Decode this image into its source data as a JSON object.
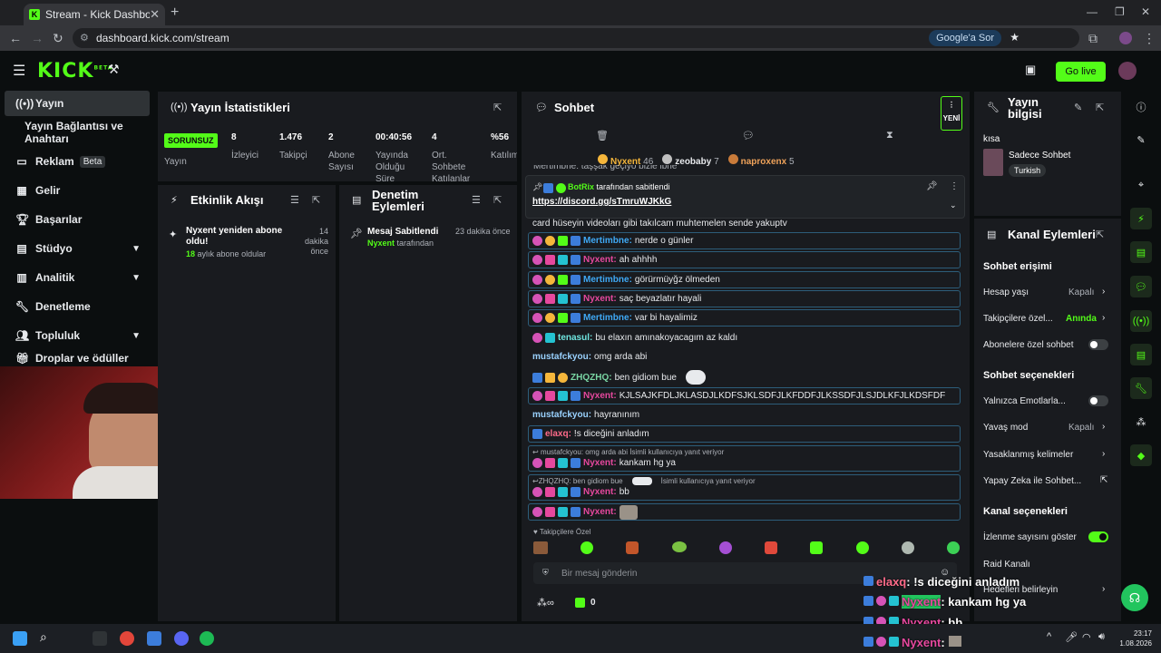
{
  "browser": {
    "tab_title": "Stream - Kick Dashboard",
    "url": "dashboard.kick.com/stream",
    "google_button": "Google'a Sor"
  },
  "header": {
    "logo": "KICK",
    "logo_sup": "BETA",
    "go_live": "Go live"
  },
  "sidebar": {
    "items": [
      {
        "label": "Yayın"
      },
      {
        "label": "Yayın Bağlantısı ve Anahtarı"
      },
      {
        "label": "Reklam",
        "badge": "Beta"
      },
      {
        "label": "Gelir"
      },
      {
        "label": "Başarılar"
      },
      {
        "label": "Stüdyo"
      },
      {
        "label": "Analitik"
      },
      {
        "label": "Denetleme"
      },
      {
        "label": "Topluluk"
      },
      {
        "label": "Droplar ve ödüller"
      }
    ]
  },
  "stats": {
    "title": "Yayın İstatistikleri",
    "status": "SORUNSUZ",
    "status_label": "Yayın",
    "items": [
      {
        "value": "8",
        "label": "İzleyici"
      },
      {
        "value": "1.476",
        "label": "Takipçi"
      },
      {
        "value": "2",
        "label": "Abone Sayısı"
      },
      {
        "value": "00:40:56",
        "label": "Yayında Olduğu Süre"
      },
      {
        "value": "4",
        "label": "Ort. Sohbete Katılanlar"
      },
      {
        "value": "%56",
        "label": "Katılım"
      }
    ]
  },
  "activity": {
    "title": "Etkinlik Akışı",
    "event_title": "Nyxent yeniden abone oldu!",
    "event_sub_count": "18",
    "event_sub_text": "aylık abone oldular",
    "event_time": "14 dakika önce"
  },
  "moderation": {
    "title": "Denetim Eylemleri",
    "action_title": "Mesaj Sabitlendi",
    "action_user": "Nyxent",
    "action_suffix": "tarafından",
    "action_time": "23 dakika önce"
  },
  "chat": {
    "title": "Sohbet",
    "new_label": "YENİ",
    "leaders": [
      {
        "name": "Nyxent",
        "count": "46"
      },
      {
        "name": "zeobaby",
        "count": "7"
      },
      {
        "name": "naproxenx",
        "count": "5"
      }
    ],
    "cut_line": "Mertimbne: taşşak geçiyo bizle ibne",
    "pinned": {
      "user": "BotRix",
      "pinned_text": "tarafından sabitlendi",
      "link": "https://discord.gg/sTmruWJKkG"
    },
    "partial_line": "card hüseyin videoları gibi takılcam muhtemelen sende yakuptv",
    "messages": [
      {
        "name": "Mertimbne",
        "text": "nerde o günler",
        "color": "#3fa9f5"
      },
      {
        "name": "Nyxent",
        "text": "ah ahhhh",
        "color": "#e6489e"
      },
      {
        "name": "Mertimbne",
        "text": "görürmüyğz ölmeden",
        "color": "#3fa9f5"
      },
      {
        "name": "Nyxent",
        "text": "saç beyazlatır hayali",
        "color": "#e6489e"
      },
      {
        "name": "Mertimbne",
        "text": "var bi hayalimiz",
        "color": "#3fa9f5"
      },
      {
        "name": "tenasul",
        "text": "bu elaxın amınakoyacagım az kaldı",
        "color": "#6fe6e0"
      },
      {
        "name": "mustafckyou",
        "text": "omg arda abi",
        "color": "#9ad2ff"
      },
      {
        "name": "ZHQZHQ",
        "text": "ben gidiom bue",
        "color": "#7ad7a4"
      },
      {
        "name": "Nyxent",
        "text": "KJLSAJKFDLJKLASDJLKDFSJKLSDFJLKFDDFJLKSSDFJLSJDLKFJLKDSFDF",
        "color": "#e6489e"
      },
      {
        "name": "mustafckyou",
        "text": "hayranınım",
        "color": "#9ad2ff"
      },
      {
        "name": "elaxq",
        "text": "!s diceğini anladım",
        "color": "#ff6b8a"
      },
      {
        "reply": "mustafckyou: omg arda abi İsimli kullanıcıya yanıt veriyor",
        "name": "Nyxent",
        "text": "kankam hg ya",
        "color": "#e6489e"
      },
      {
        "reply": "ZHQZHQ: ben gidiom bue",
        "reply_suffix": "İsimli kullanıcıya yanıt veriyor",
        "name": "Nyxent",
        "text": "bb",
        "color": "#e6489e"
      },
      {
        "name": "Nyxent",
        "text": "",
        "color": "#e6489e"
      }
    ],
    "emote_section": "Takipçilere Özel",
    "input_placeholder": "Bir mesaj gönderin",
    "points": "0"
  },
  "stream_info": {
    "title": "Yayın bilgisi",
    "stream_title": "kısa",
    "category": "Sadece Sohbet",
    "tag": "Turkish"
  },
  "channel_actions": {
    "title": "Kanal Eylemleri",
    "chat_access": "Sohbet erişimi",
    "account_age": "Hesap yaşı",
    "account_age_val": "Kapalı",
    "followers_only": "Takipçilere özel...",
    "followers_only_val": "Anında",
    "subs_only": "Abonelere özel sohbet",
    "chat_options": "Sohbet seçenekleri",
    "emotes_only": "Yalnızca Emotlarla...",
    "slow_mode": "Yavaş mod",
    "slow_mode_val": "Kapalı",
    "banned_words": "Yasaklanmış kelimeler",
    "ai_chat": "Yapay Zeka ile Sohbet...",
    "channel_options": "Kanal seçenekleri",
    "show_viewers": "İzlenme sayısını göster",
    "raid": "Raid Kanalı",
    "goals": "Hedefleri belirleyin"
  },
  "overlay": [
    {
      "name": "elaxq",
      "text": ": !s diceğini anladım",
      "color": "#ff6b8a"
    },
    {
      "name": "Nyxent",
      "text": ": kankam hg ya",
      "color": "#e6489e"
    },
    {
      "name": "Nyxent",
      "text": ": bb",
      "color": "#e6489e"
    },
    {
      "name": "Nyxent",
      "text": ":",
      "color": "#e6489e"
    }
  ],
  "taskbar": {
    "time": "23:17",
    "date": "1.08.2026"
  },
  "colors": {
    "accent": "#53fc18",
    "panel": "#191b1f",
    "bg": "#0b0e0f"
  }
}
